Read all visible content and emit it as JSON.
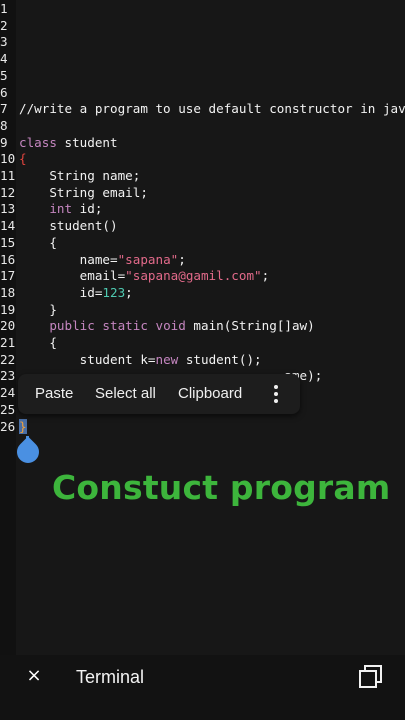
{
  "editor": {
    "lines": [
      {
        "n": "1",
        "segments": []
      },
      {
        "n": "2",
        "segments": []
      },
      {
        "n": "3",
        "segments": []
      },
      {
        "n": "4",
        "segments": []
      },
      {
        "n": "5",
        "segments": []
      },
      {
        "n": "6",
        "segments": []
      },
      {
        "n": "7",
        "segments": [
          {
            "t": "//write a program to use default constructor in java.",
            "c": "plain"
          }
        ]
      },
      {
        "n": "8",
        "segments": []
      },
      {
        "n": "9",
        "segments": [
          {
            "t": "class",
            "c": "kw"
          },
          {
            "t": " student",
            "c": "plain"
          }
        ]
      },
      {
        "n": "10",
        "segments": [
          {
            "t": "{",
            "c": "brace-red"
          }
        ]
      },
      {
        "n": "11",
        "segments": [
          {
            "t": "    String name;",
            "c": "plain"
          }
        ]
      },
      {
        "n": "12",
        "segments": [
          {
            "t": "    String email;",
            "c": "plain"
          }
        ]
      },
      {
        "n": "13",
        "segments": [
          {
            "t": "    ",
            "c": "plain"
          },
          {
            "t": "int",
            "c": "kw"
          },
          {
            "t": " id;",
            "c": "plain"
          }
        ]
      },
      {
        "n": "14",
        "segments": [
          {
            "t": "    student()",
            "c": "plain"
          }
        ]
      },
      {
        "n": "15",
        "segments": [
          {
            "t": "    {",
            "c": "plain"
          }
        ]
      },
      {
        "n": "16",
        "segments": [
          {
            "t": "        name=",
            "c": "plain"
          },
          {
            "t": "\"sapana\"",
            "c": "str"
          },
          {
            "t": ";",
            "c": "plain"
          }
        ]
      },
      {
        "n": "17",
        "segments": [
          {
            "t": "        email=",
            "c": "plain"
          },
          {
            "t": "\"sapana@gamil.com\"",
            "c": "str"
          },
          {
            "t": ";",
            "c": "plain"
          }
        ]
      },
      {
        "n": "18",
        "segments": [
          {
            "t": "        id=",
            "c": "plain"
          },
          {
            "t": "123",
            "c": "num"
          },
          {
            "t": ";",
            "c": "plain"
          }
        ]
      },
      {
        "n": "19",
        "segments": [
          {
            "t": "    }",
            "c": "plain"
          }
        ]
      },
      {
        "n": "20",
        "segments": [
          {
            "t": "    ",
            "c": "plain"
          },
          {
            "t": "public static void",
            "c": "kw"
          },
          {
            "t": " main(String[]aw)",
            "c": "plain"
          }
        ]
      },
      {
        "n": "21",
        "segments": [
          {
            "t": "    {",
            "c": "plain"
          }
        ]
      },
      {
        "n": "22",
        "segments": [
          {
            "t": "        student k=",
            "c": "plain"
          },
          {
            "t": "new",
            "c": "kw"
          },
          {
            "t": " student();",
            "c": "plain"
          }
        ]
      },
      {
        "n": "23",
        "segments": [
          {
            "t": "                                   ame);",
            "c": "plain"
          }
        ]
      },
      {
        "n": "24",
        "segments": []
      },
      {
        "n": "25",
        "segments": []
      },
      {
        "n": "26",
        "segments": [
          {
            "t": "}",
            "c": "cursor-hl"
          }
        ]
      }
    ]
  },
  "context_menu": {
    "paste": "Paste",
    "select_all": "Select all",
    "clipboard": "Clipboard",
    "more_icon": "more-vertical-icon"
  },
  "overlay": {
    "title": "Constuct program",
    "color": "#3db53c"
  },
  "bottom_bar": {
    "close_icon": "close-icon",
    "close_symbol": "×",
    "label": "Terminal",
    "windows_icon": "windows-icon"
  }
}
